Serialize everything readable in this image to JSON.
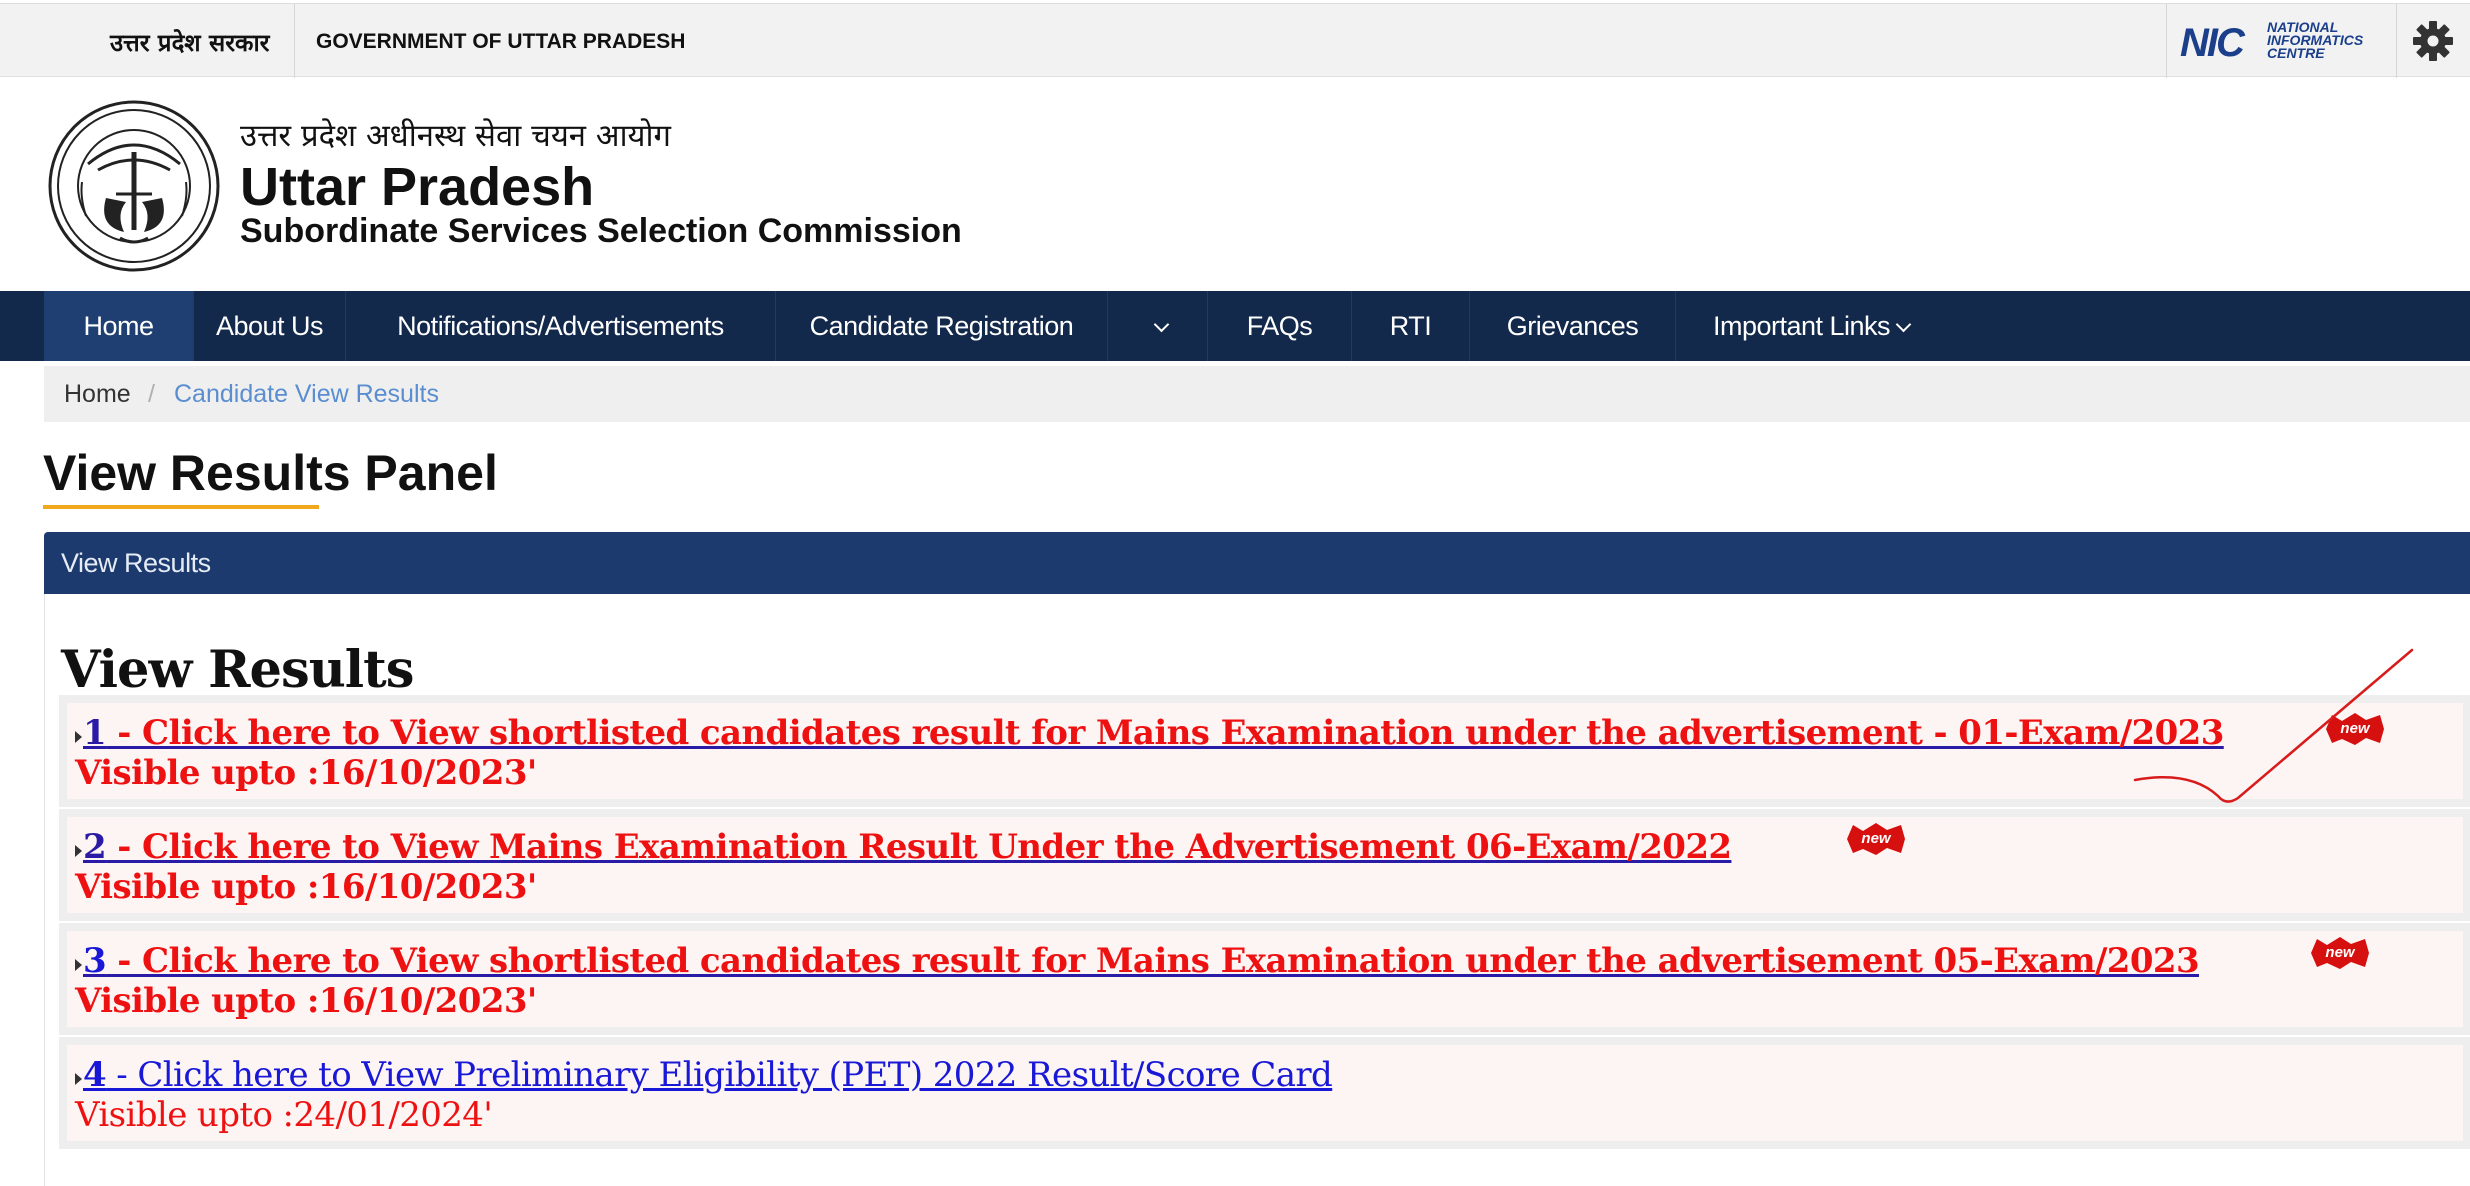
{
  "topbar": {
    "gov_hindi": "उत्तर प्रदेश सरकार",
    "gov_english": "GOVERNMENT OF UTTAR PRADESH",
    "nic_mark": "NIC",
    "nic_text": [
      "NATIONAL",
      "INFORMATICS",
      "CENTRE"
    ]
  },
  "header": {
    "title_hindi": "उत्तर प्रदेश अधीनस्थ सेवा चयन आयोग",
    "title_main": "Uttar Pradesh",
    "title_sub": "Subordinate Services Selection Commission"
  },
  "nav": {
    "items": [
      {
        "label": "Home"
      },
      {
        "label": "About Us"
      },
      {
        "label": "Notifications/Advertisements"
      },
      {
        "label": "Candidate Registration"
      },
      {
        "label": ""
      },
      {
        "label": "FAQs"
      },
      {
        "label": "RTI"
      },
      {
        "label": "Grievances"
      },
      {
        "label": "Important Links"
      }
    ]
  },
  "breadcrumb": {
    "home": "Home",
    "separator": "/",
    "current": "Candidate View Results"
  },
  "page": {
    "title": "View Results Panel"
  },
  "panel": {
    "header": "View Results",
    "heading": "View Results",
    "results": [
      {
        "num": "1",
        "text": " - Click here to View shortlisted candidates result for Mains Examination under the advertisement - 01-Exam/2023",
        "visible": "Visible upto :16/10/2023'",
        "is_new": true
      },
      {
        "num": "2",
        "text": " - Click here to View Mains Examination Result Under the Advertisement 06-Exam/2022",
        "visible": "Visible upto :16/10/2023'",
        "is_new": true
      },
      {
        "num": "3",
        "text": " - Click here to View shortlisted candidates result for Mains Examination under the advertisement 05-Exam/2023",
        "visible": "Visible upto :16/10/2023'",
        "is_new": true
      },
      {
        "num": "4",
        "text": " - Click here to View Preliminary Eligibility (PET) 2022 Result/Score Card",
        "visible": "Visible upto :24/01/2024'",
        "is_new": false
      }
    ],
    "new_badge_text": "new"
  },
  "colors": {
    "nav_bg": "#13294b",
    "panel_header_bg": "#1c3a6e",
    "accent_underline": "#f2a81d",
    "result_red": "#ee1111",
    "link_blue": "#1818d6"
  }
}
